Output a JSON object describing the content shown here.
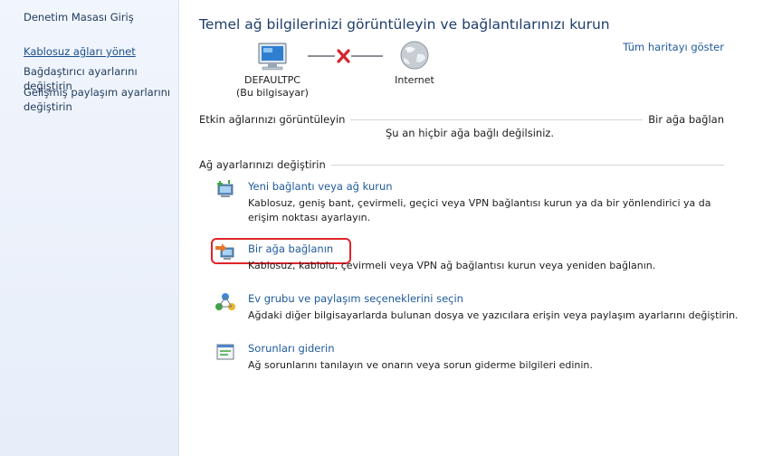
{
  "sidebar": {
    "home": "Denetim Masası Giriş",
    "links": [
      {
        "label": "Kablosuz ağları yönet"
      },
      {
        "label": "Bağdaştırıcı ayarlarını değiştirin"
      },
      {
        "label": "Gelişmiş paylaşım ayarlarını değiştirin"
      }
    ]
  },
  "main": {
    "title": "Temel ağ bilgilerinizi görüntüleyin ve bağlantılarınızı kurun",
    "full_map_link": "Tüm haritayı göster",
    "network_map": {
      "computer_name": "DEFAULTPC",
      "computer_subtitle": "(Bu bilgisayar)",
      "internet_label": "Internet"
    },
    "active_networks": {
      "label": "Etkin ağlarınızı görüntüleyin",
      "connect_link": "Bir ağa bağlan",
      "status": "Şu an hiçbir ağa bağlı değilsiniz."
    },
    "change_settings": {
      "label": "Ağ ayarlarınızı değiştirin",
      "tasks": [
        {
          "title": "Yeni bağlantı veya ağ kurun",
          "desc": "Kablosuz, geniş bant, çevirmeli, geçici veya VPN bağlantısı kurun ya da bir yönlendirici ya da erişim noktası ayarlayın.",
          "icon": "new-connection-icon"
        },
        {
          "title": "Bir ağa bağlanın",
          "desc": "Kablosuz, kablolu, çevirmeli veya VPN ağ bağlantısı kurun veya yeniden bağlanın.",
          "icon": "connect-network-icon"
        },
        {
          "title": "Ev grubu ve paylaşım seçeneklerini seçin",
          "desc": "Ağdaki diğer bilgisayarlarda bulunan dosya ve yazıcılara erişin veya paylaşım ayarlarını değiştirin.",
          "icon": "homegroup-icon"
        },
        {
          "title": "Sorunları giderin",
          "desc": "Ağ sorunlarını tanılayın ve onarın veya sorun giderme bilgileri edinin.",
          "icon": "troubleshoot-icon"
        }
      ]
    }
  },
  "colors": {
    "link": "#1f5a9a",
    "title": "#1e3d6b",
    "highlight": "#e0242a",
    "sidebar_bg": "#eaf0fa"
  }
}
